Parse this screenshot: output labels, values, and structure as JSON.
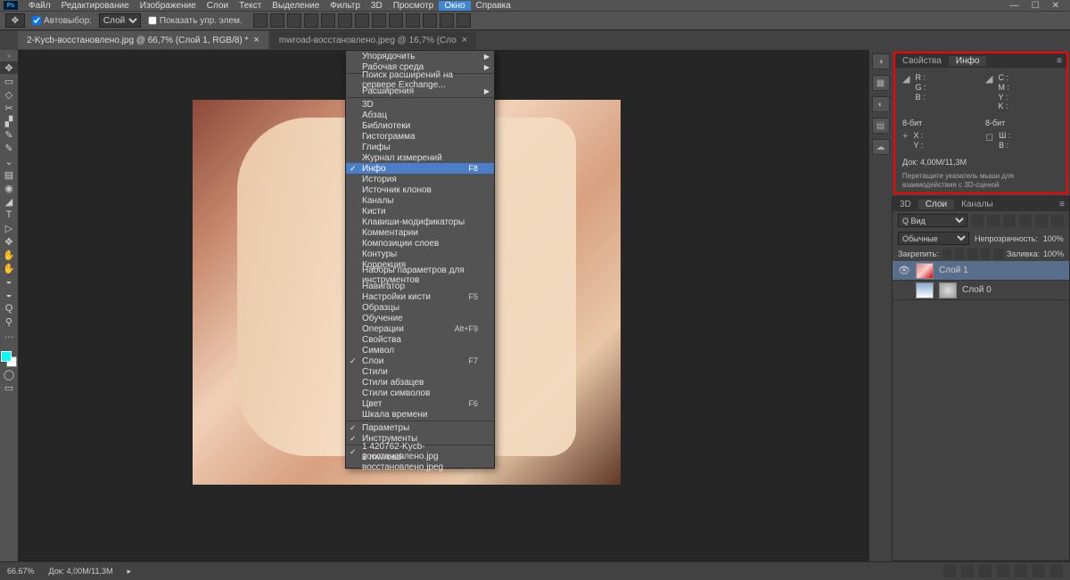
{
  "app_logo": "Ps",
  "menu": {
    "items": [
      "Файл",
      "Редактирование",
      "Изображение",
      "Слои",
      "Текст",
      "Выделение",
      "Фильтр",
      "3D",
      "Просмотр",
      "Окно",
      "Справка"
    ],
    "open_index": 9
  },
  "window_menu": {
    "items": [
      {
        "label": "Упорядочить",
        "submenu": true
      },
      {
        "label": "Рабочая среда",
        "submenu": true
      },
      {
        "sep": true
      },
      {
        "label": "Поиск расширений на сервере Exchange..."
      },
      {
        "label": "Расширения",
        "submenu": true
      },
      {
        "sep": true
      },
      {
        "label": "3D"
      },
      {
        "label": "Абзац"
      },
      {
        "label": "Библиотеки"
      },
      {
        "label": "Гистограмма"
      },
      {
        "label": "Глифы"
      },
      {
        "label": "Журнал измерений"
      },
      {
        "label": "Инфо",
        "shortcut": "F8",
        "checked": true,
        "highlight": true
      },
      {
        "label": "История"
      },
      {
        "label": "Источник клонов"
      },
      {
        "label": "Каналы"
      },
      {
        "label": "Кисти"
      },
      {
        "label": "Клавиши-модификаторы"
      },
      {
        "label": "Комментарии"
      },
      {
        "label": "Композиции слоев"
      },
      {
        "label": "Контуры"
      },
      {
        "label": "Коррекция"
      },
      {
        "label": "Наборы параметров для инструментов"
      },
      {
        "label": "Навигатор"
      },
      {
        "label": "Настройки кисти",
        "shortcut": "F5"
      },
      {
        "label": "Образцы"
      },
      {
        "label": "Обучение"
      },
      {
        "label": "Операции",
        "shortcut": "Alt+F9"
      },
      {
        "label": "Свойства"
      },
      {
        "label": "Символ"
      },
      {
        "label": "Слои",
        "shortcut": "F7",
        "checked": true
      },
      {
        "label": "Стили"
      },
      {
        "label": "Стили абзацев"
      },
      {
        "label": "Стили символов"
      },
      {
        "label": "Цвет",
        "shortcut": "F6"
      },
      {
        "label": "Шкала времени"
      },
      {
        "sep": true
      },
      {
        "label": "Параметры",
        "checked": true
      },
      {
        "label": "Инструменты",
        "checked": true
      },
      {
        "sep": true
      },
      {
        "label": "1 420762-Kycb-восстановлено.jpg",
        "checked": true
      },
      {
        "label": "2 mwroad-восстановлено.jpeg"
      }
    ]
  },
  "options": {
    "autoselect_label": "Автовыбор:",
    "autoselect_dropdown": "Слой",
    "show_controls_label": "Показать упр. элем.",
    "tool_icon": "✥"
  },
  "tabs": [
    {
      "title": "2-Kycb-восстановлено.jpg @ 66,7% (Слой 1, RGB/8) *",
      "active": true
    },
    {
      "title": "mwroad-восстановлено.jpeg @ 16,7% (Сло",
      "active": false
    }
  ],
  "tools": [
    "✥",
    "▭",
    "◇",
    "✂",
    "▞",
    "✎",
    "✎",
    "⌄",
    "▤",
    "◉",
    "◢",
    "T",
    "▷",
    "✥",
    "✋",
    "✋",
    "◒",
    "◒",
    "Q",
    "⚲",
    "…"
  ],
  "panels": {
    "properties": {
      "tabs": [
        "Свойства",
        "Инфо"
      ],
      "active": 1
    },
    "info": {
      "rgb_label": "R :\nG :\nB :",
      "cmyk_label": "C :\nM :\nY :\nK :",
      "bit": "8-бит",
      "bit2": "8-бит",
      "xy_label": "X :\nY :",
      "wh_label": "Ш :\nВ :",
      "doc": "Док: 4,00M/11,3M",
      "hint": "Перетащите указатель мыши для взаимодействия с 3D-сценой."
    },
    "layers": {
      "tabs": [
        "3D",
        "Слои",
        "Каналы"
      ],
      "active": 1,
      "filter_label": "Q Вид",
      "blend_mode": "Обычные",
      "opacity_label": "Непрозрачность:",
      "opacity_val": "100%",
      "lock_label": "Закрепить:",
      "fill_label": "Заливка:",
      "fill_val": "100%",
      "rows": [
        {
          "name": "Слой 1",
          "visible": true,
          "selected": true,
          "thumb": "img1"
        },
        {
          "name": "Слой 0",
          "visible": false,
          "selected": false,
          "thumb": "img2"
        }
      ]
    }
  },
  "status": {
    "zoom": "66.67%",
    "doc": "Док: 4,00M/11,3M"
  }
}
